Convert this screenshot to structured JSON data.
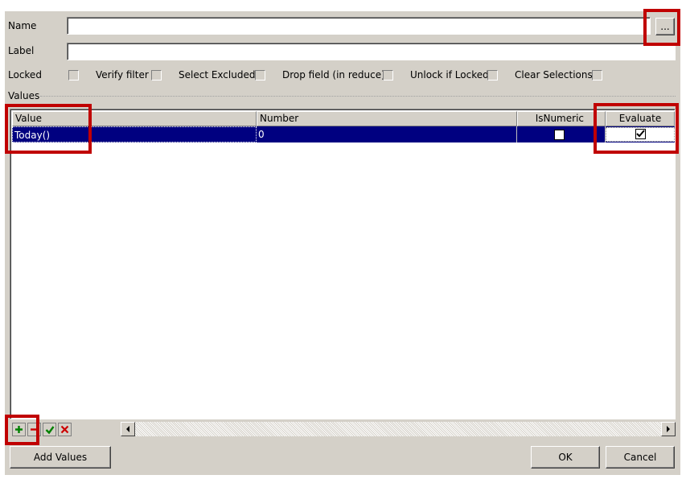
{
  "form": {
    "name_label": "Name",
    "name_value": "",
    "browse_label": "...",
    "label_label": "Label",
    "label_value": "",
    "values_label": "Values"
  },
  "options": [
    {
      "label": "Locked",
      "checked": false
    },
    {
      "label": "Verify filter",
      "checked": false
    },
    {
      "label": "Select Excluded",
      "checked": false
    },
    {
      "label": "Drop field (in reduce)",
      "checked": false
    },
    {
      "label": "Unlock if Locked",
      "checked": false
    },
    {
      "label": "Clear Selections",
      "checked": false
    }
  ],
  "grid": {
    "columns": [
      "Value",
      "Number",
      "IsNumeric",
      "Evaluate"
    ],
    "rows": [
      {
        "value": "Today()",
        "number": "0",
        "isnumeric": false,
        "evaluate": true
      }
    ]
  },
  "toolbar": {
    "add_icon": "plus-icon",
    "remove_icon": "minus-icon",
    "accept_icon": "check-icon",
    "delete_icon": "x-icon",
    "add_color": "#008000",
    "remove_color": "#cc0000",
    "accept_color": "#008000",
    "delete_color": "#cc0000"
  },
  "buttons": {
    "add_values": "Add Values",
    "ok": "OK",
    "cancel": "Cancel"
  },
  "colors": {
    "dialog_bg": "#d4d0c8",
    "selection": "#000080",
    "annotation": "#c00000"
  }
}
